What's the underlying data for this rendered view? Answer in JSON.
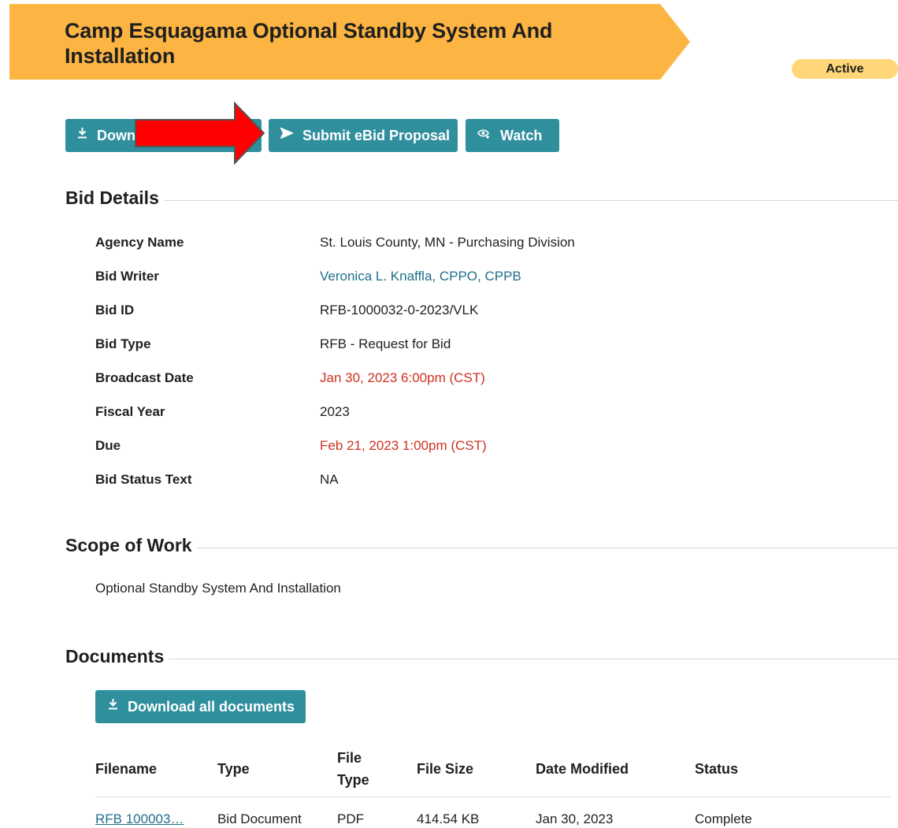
{
  "header": {
    "title": "Camp Esquagama Optional Standby System And Installation",
    "status": "Active"
  },
  "actions": {
    "download_label": "Down",
    "submit_label": "Submit eBid Proposal",
    "watch_label": "Watch"
  },
  "bid_details": {
    "heading": "Bid Details",
    "rows": [
      {
        "label": "Agency Name",
        "value": "St. Louis County, MN - Purchasing Division"
      },
      {
        "label": "Bid Writer",
        "value": "Veronica L. Knaffla, CPPO, CPPB"
      },
      {
        "label": "Bid ID",
        "value": "RFB-1000032-0-2023/VLK"
      },
      {
        "label": "Bid Type",
        "value": "RFB - Request for Bid"
      },
      {
        "label": "Broadcast Date",
        "value": "Jan 30, 2023 6:00pm (CST)"
      },
      {
        "label": "Fiscal Year",
        "value": "2023"
      },
      {
        "label": "Due",
        "value": "Feb 21, 2023 1:00pm (CST)"
      },
      {
        "label": "Bid Status Text",
        "value": "NA"
      }
    ]
  },
  "scope": {
    "heading": "Scope of Work",
    "text": "Optional Standby System And Installation"
  },
  "documents": {
    "heading": "Documents",
    "download_all_label": "Download all documents",
    "columns": [
      "Filename",
      "Type",
      "File Type",
      "File Size",
      "Date Modified",
      "Status"
    ],
    "rows": [
      {
        "filename": "RFB 100003…",
        "type": "Bid Document",
        "file_type": "PDF",
        "file_size": "414.54 KB",
        "date_modified": "Jan 30, 2023",
        "status": "Complete"
      }
    ]
  },
  "colors": {
    "banner": "#fcb542",
    "status_pill": "#ffd779",
    "button": "#2f8f9d",
    "link": "#1f6f8b",
    "date_red": "#d0301f",
    "annotation_arrow": "#ff0000"
  },
  "icons": {
    "download": "download-icon",
    "submit": "send-icon",
    "watch": "eye-plus-icon"
  }
}
